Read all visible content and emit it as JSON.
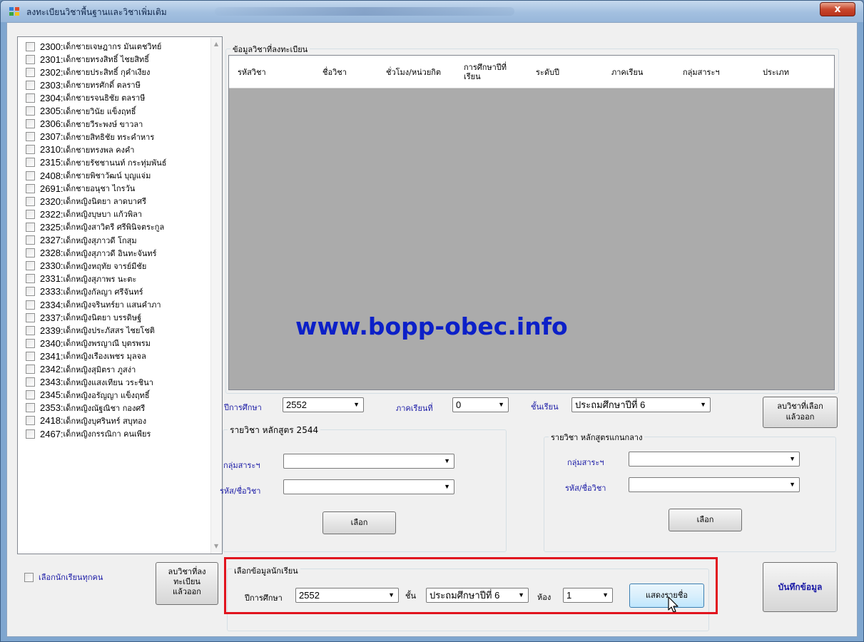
{
  "window": {
    "title": "ลงทะเบียนวิชาพื้นฐานและวิชาเพิ่มเติม",
    "close_label": "x"
  },
  "students": [
    {
      "id": "2300",
      "name": "เด็กชายเจษฎากร มันเตชวิทย์"
    },
    {
      "id": "2301",
      "name": "เด็กชายทรงสิทธิ์ ไชยสิทธิ์"
    },
    {
      "id": "2302",
      "name": "เด็กชายประสิทธิ์ กุคำเงียง"
    },
    {
      "id": "2303",
      "name": "เด็กชายทรศักดิ์ ตลราษี"
    },
    {
      "id": "2304",
      "name": "เด็กชายรจนธิชัย ตลราษี"
    },
    {
      "id": "2305",
      "name": "เด็กชายวินัย แข็งฤทธิ์"
    },
    {
      "id": "2306",
      "name": "เด็กชายวีระพงษ์ ขาวลา"
    },
    {
      "id": "2307",
      "name": "เด็กชายสิทธิชัย ทระคำหาร"
    },
    {
      "id": "2310",
      "name": "เด็กชายทรงพล คงคำ"
    },
    {
      "id": "2315",
      "name": "เด็กชายรัชชานนท์ กระทุ่มพันธ์"
    },
    {
      "id": "2408",
      "name": "เด็กชายพิชาวัฒน์ บุญแจ่ม"
    },
    {
      "id": "2691",
      "name": "เด็กชายอนุชา ไกรวัน"
    },
    {
      "id": "2320",
      "name": "เด็กหญิงนิตยา ลาดบาศรี"
    },
    {
      "id": "2322",
      "name": "เด็กหญิงบุษบา แก้วพิลา"
    },
    {
      "id": "2325",
      "name": "เด็กหญิงสาวิตรี ศรีพินิจตระกูล"
    },
    {
      "id": "2327",
      "name": "เด็กหญิงสุภาวดี โกสุม"
    },
    {
      "id": "2328",
      "name": "เด็กหญิงสุภาวดี อินทะจันทร์"
    },
    {
      "id": "2330",
      "name": "เด็กหญิงหฤทัย จารย์มีชัย"
    },
    {
      "id": "2331",
      "name": "เด็กหญิงสุภาพร นะตะ"
    },
    {
      "id": "2333",
      "name": "เด็กหญิงกัลญา ศรีจันทร์"
    },
    {
      "id": "2334",
      "name": "เด็กหญิงจรินทร์ยา แสนคำภา"
    },
    {
      "id": "2337",
      "name": "เด็กหญิงนิตยา บรรดิษฐ์"
    },
    {
      "id": "2339",
      "name": "เด็กหญิงประภัสสร ไชยโชติ"
    },
    {
      "id": "2340",
      "name": "เด็กหญิงพรญาณี บุตรพรม"
    },
    {
      "id": "2341",
      "name": "เด็กหญิงเรืองเพชร มุลจล"
    },
    {
      "id": "2342",
      "name": "เด็กหญิงสุมิตรา ภูสง่า"
    },
    {
      "id": "2343",
      "name": "เด็กหญิงแสงเทียน วระชินา"
    },
    {
      "id": "2345",
      "name": "เด็กหญิงอรัญญา แข็งฤทธิ์"
    },
    {
      "id": "2353",
      "name": "เด็กหญิงณัฐณิชา กองศรี"
    },
    {
      "id": "2418",
      "name": "เด็กหญิงบุศรินทร์ สบุทอง"
    },
    {
      "id": "2467",
      "name": "เด็กหญิงกรรณิกา คนเพียร"
    }
  ],
  "left_footer": {
    "select_all_label": "เลือกนักเรียนทุกคน",
    "delete_close_line1": "ลบวิชาที่ลง",
    "delete_close_line2": "ทะเบียน",
    "delete_close_line3": "แล้วออก"
  },
  "subjects_group": {
    "title": "ข้อมูลวิชาที่ลงทะเบียน",
    "columns": [
      "รหัสวิชา",
      "ชื่อวิชา",
      "ชั่วโมง/หน่วยกิต",
      "การศึกษาปีที่",
      "เรียน",
      "ระดับปี",
      "ภาคเรียน",
      "กลุ่มสาระฯ",
      "ประเภท"
    ],
    "watermark": "www.bopp-obec.info"
  },
  "filters": {
    "year_label": "ปีการศึกษา",
    "year_value": "2552",
    "term_label": "ภาคเรียนที่",
    "term_value": "0",
    "level_label": "ชั้นเรียน",
    "level_value": "ประถมศึกษาปีที่ 6",
    "delete_selected_line1": "ลบวิชาที่เลือก",
    "delete_selected_line2": "แล้วออก"
  },
  "curriculum_2544": {
    "title": "รายวิชา หลักสูตร 2544",
    "group_label": "กลุ่มสาระฯ",
    "code_label": "รหัส/ชื่อวิชา",
    "group_value": "",
    "code_value": "",
    "select_label": "เลือก"
  },
  "curriculum_core": {
    "title": "รายวิชา หลักสูตรแกนกลาง",
    "group_label": "กลุ่มสาระฯ",
    "code_label": "รหัส/ชื่อวิชา",
    "group_value": "",
    "code_value": "",
    "select_label": "เลือก"
  },
  "student_select": {
    "title": "เลือกข้อมูลนักเรียน",
    "year_label": "ปีการศึกษา",
    "year_value": "2552",
    "class_label": "ชั้น",
    "class_value": "ประถมศึกษาปีที่ 6",
    "room_label": "ห้อง",
    "room_value": "1",
    "show_names_label": "แสดงรายชื่อ",
    "highlight_color": "#e1141e"
  },
  "save_label": "บันทึกข้อมูล"
}
